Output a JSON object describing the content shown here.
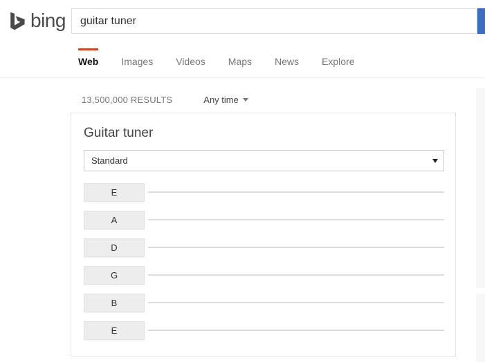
{
  "header": {
    "logo_word": "bing",
    "logo_icon": "bing-swoosh-icon",
    "search_value": "guitar tuner",
    "search_placeholder": "",
    "search_button_icon": "search-icon",
    "search_button_label": ""
  },
  "nav": {
    "tabs": [
      {
        "label": "Web",
        "active": true
      },
      {
        "label": "Images",
        "active": false
      },
      {
        "label": "Videos",
        "active": false
      },
      {
        "label": "Maps",
        "active": false
      },
      {
        "label": "News",
        "active": false
      },
      {
        "label": "Explore",
        "active": false
      }
    ],
    "active_underline_color": "#cc4422"
  },
  "results_meta": {
    "count_text": "13,500,000 RESULTS",
    "time_filter_label": "Any time",
    "time_filter_icon": "chevron-down-icon"
  },
  "tuner_card": {
    "title": "Guitar tuner",
    "tuning_selected": "Standard",
    "tuning_options": [
      "Standard"
    ],
    "select_caret_icon": "chevron-down-icon",
    "strings": [
      {
        "note": "E"
      },
      {
        "note": "A"
      },
      {
        "note": "D"
      },
      {
        "note": "G"
      },
      {
        "note": "B"
      },
      {
        "note": "E"
      }
    ]
  },
  "colors": {
    "accent_orange": "#cc4422",
    "search_button_blue": "#3b6ec1",
    "card_border": "#e3e3e3",
    "string_line": "#dcdcdc",
    "note_button_bg": "#ededed"
  }
}
